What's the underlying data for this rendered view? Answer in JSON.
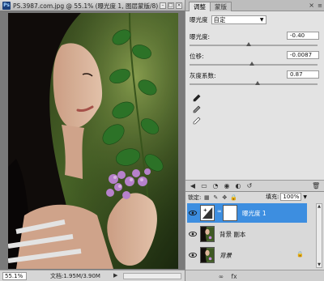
{
  "document": {
    "title": "PS.3987.com.jpg @ 55.1% (曝光度 1, 图层蒙版/8) *",
    "zoom": "55.1%",
    "doc_info": "文档:1.95M/3.90M"
  },
  "panel_tabs": [
    {
      "label": "调整",
      "active": true
    },
    {
      "label": "蒙版",
      "active": false
    }
  ],
  "adjustment": {
    "title": "曝光度",
    "preset_value": "自定",
    "params": [
      {
        "label": "曝光度:",
        "value": "-0.40",
        "slider_fraction": 0.46
      },
      {
        "label": "位移:",
        "value": "-0.0087",
        "slider_fraction": 0.49
      },
      {
        "label": "灰度系数:",
        "value": "0.87",
        "slider_fraction": 0.53
      }
    ],
    "droppers": [
      "black-eyedropper-icon",
      "gray-eyedropper-icon",
      "white-eyedropper-icon"
    ]
  },
  "layers": {
    "lock_label": "锁定:",
    "fill_label": "填充:",
    "fill_value": "100%",
    "items": [
      {
        "name": "曝光度 1",
        "selected": true
      },
      {
        "name": "背景 副本",
        "selected": false
      },
      {
        "name": "背景",
        "selected": false
      }
    ]
  },
  "colors": {
    "selected_layer": "#3d8ee0",
    "panel_bg": "#e3e3e3"
  }
}
